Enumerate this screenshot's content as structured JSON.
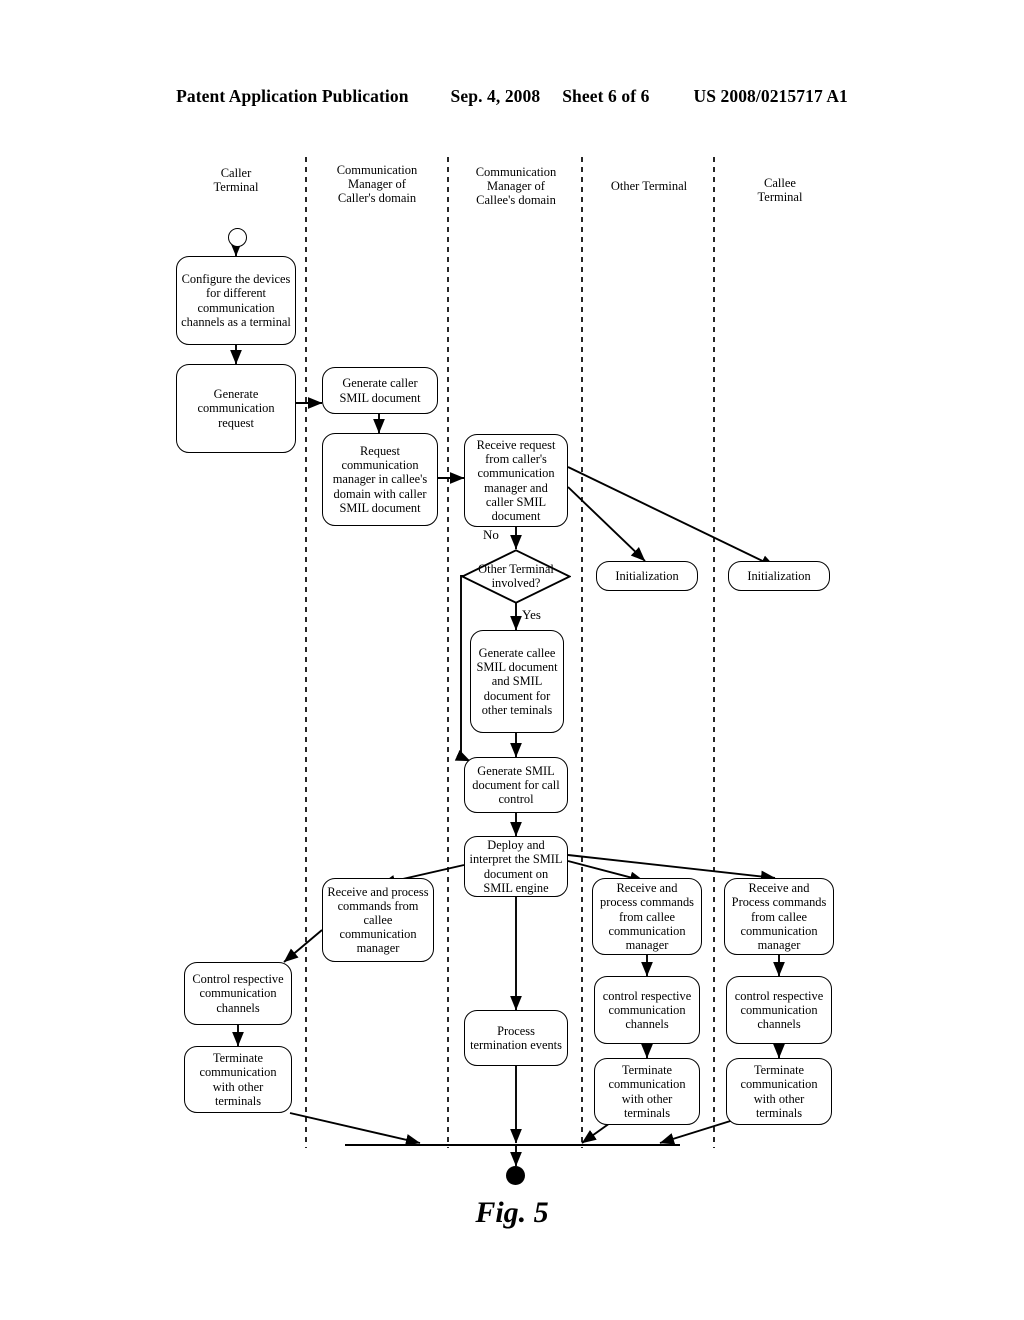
{
  "header": {
    "publication": "Patent Application Publication",
    "date": "Sep. 4, 2008",
    "sheet": "Sheet 6 of 6",
    "patent_number": "US 2008/0215717 A1"
  },
  "figure": {
    "caption": "Fig. 5"
  },
  "lanes": [
    {
      "id": "caller-terminal",
      "label": "Caller\nTerminal"
    },
    {
      "id": "cm-caller-domain",
      "label": "Communication\nManager of\nCaller's domain"
    },
    {
      "id": "cm-callee-domain",
      "label": "Communication\nManager of\nCallee's domain"
    },
    {
      "id": "other-terminal",
      "label": "Other Terminal"
    },
    {
      "id": "callee-terminal",
      "label": "Callee\nTerminal"
    }
  ],
  "nodes": [
    {
      "id": "configure-devices",
      "text": "Configure the devices for different communication channels as a terminal"
    },
    {
      "id": "generate-comm-request",
      "text": "Generate communication request"
    },
    {
      "id": "generate-caller-smil",
      "text": "Generate caller SMIL document"
    },
    {
      "id": "request-cm-callee-domain",
      "text": "Request communication manager in callee's domain with caller SMIL document"
    },
    {
      "id": "receive-request",
      "text": "Receive request from caller's communication manager and caller SMIL document"
    },
    {
      "id": "other-terminal-involved",
      "text": "Other Terminal involved?"
    },
    {
      "id": "generate-callee-smil",
      "text": "Generate callee SMIL document and SMIL document for other teminals"
    },
    {
      "id": "generate-callcontrol-smil",
      "text": "Generate SMIL document for call control"
    },
    {
      "id": "deploy-interpret-smil",
      "text": "Deploy and interpret the SMIL document on SMIL engine"
    },
    {
      "id": "init-other-terminal",
      "text": "Initialization"
    },
    {
      "id": "init-callee-terminal",
      "text": "Initialization"
    },
    {
      "id": "receive-process-caller",
      "text": "Receive and process commands from callee communication manager"
    },
    {
      "id": "receive-process-other",
      "text": "Receive and process commands from callee communication manager"
    },
    {
      "id": "receive-process-callee",
      "text": "Receive and Process commands from callee communication manager"
    },
    {
      "id": "control-channels-caller",
      "text": "Control respective communication channels"
    },
    {
      "id": "control-channels-other",
      "text": "control respective communication channels"
    },
    {
      "id": "control-channels-callee",
      "text": "control respective communication channels"
    },
    {
      "id": "terminate-caller",
      "text": "Terminate communication with other terminals"
    },
    {
      "id": "terminate-other",
      "text": "Terminate communication with other terminals"
    },
    {
      "id": "terminate-callee",
      "text": "Terminate communication with other terminals"
    },
    {
      "id": "process-termination",
      "text": "Process termination events"
    }
  ],
  "edge_labels": {
    "no": "No",
    "yes": "Yes"
  }
}
